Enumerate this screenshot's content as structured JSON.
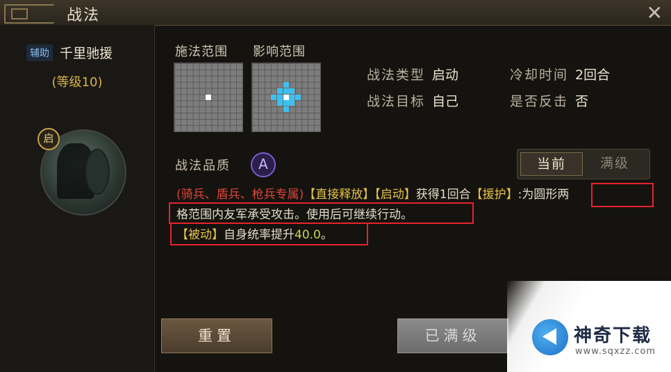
{
  "window": {
    "title": "战法",
    "close_icon": "close-icon"
  },
  "skill": {
    "tag": "辅助",
    "name": "千里驰援",
    "level_text": "(等级10)",
    "portrait_badge": "启"
  },
  "range": {
    "cast_label": "施法范围",
    "effect_label": "影响范围"
  },
  "info": {
    "type_label": "战法类型",
    "type_value": "启动",
    "cooldown_label": "冷却时间",
    "cooldown_value": "2回合",
    "target_label": "战法目标",
    "target_value": "自己",
    "counter_label": "是否反击",
    "counter_value": "否"
  },
  "quality": {
    "label": "战法品质",
    "grade": "A"
  },
  "level_toggle": {
    "current": "当前",
    "max": "满级"
  },
  "description": {
    "line1_troops": "(骑兵、盾兵、枪兵专属)",
    "line1_tag1": "【直接释放】",
    "line1_tag2": "【启动】",
    "line1_text1": "获得1回合",
    "line1_tag3": "【援护】",
    "line1_text2": ":为圆形两",
    "line2_text": "格范围内友军承受攻击。使用后可继续行动。",
    "line3_tag": "【被动】",
    "line3_text": "自身统率提升",
    "line3_value": "40.0",
    "line3_end": "。"
  },
  "buttons": {
    "reset": "重置",
    "max_level": "已满级"
  },
  "watermark": {
    "title": "神奇下载",
    "url": "www.sqxzz.com"
  },
  "colors": {
    "accent_red": "#e0443a",
    "accent_yellow": "#e6c34a",
    "highlight_blue": "#3cc0f0",
    "quality_purple": "#7c5cd6"
  }
}
